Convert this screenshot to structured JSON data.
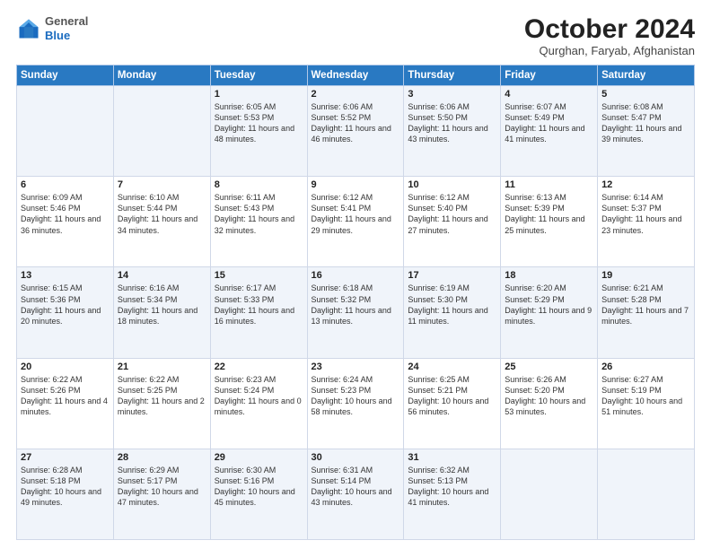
{
  "header": {
    "logo": {
      "general": "General",
      "blue": "Blue"
    },
    "title": "October 2024",
    "location": "Qurghan, Faryab, Afghanistan"
  },
  "weekdays": [
    "Sunday",
    "Monday",
    "Tuesday",
    "Wednesday",
    "Thursday",
    "Friday",
    "Saturday"
  ],
  "weeks": [
    [
      {
        "day": "",
        "sunrise": "",
        "sunset": "",
        "daylight": ""
      },
      {
        "day": "",
        "sunrise": "",
        "sunset": "",
        "daylight": ""
      },
      {
        "day": "1",
        "sunrise": "Sunrise: 6:05 AM",
        "sunset": "Sunset: 5:53 PM",
        "daylight": "Daylight: 11 hours and 48 minutes."
      },
      {
        "day": "2",
        "sunrise": "Sunrise: 6:06 AM",
        "sunset": "Sunset: 5:52 PM",
        "daylight": "Daylight: 11 hours and 46 minutes."
      },
      {
        "day": "3",
        "sunrise": "Sunrise: 6:06 AM",
        "sunset": "Sunset: 5:50 PM",
        "daylight": "Daylight: 11 hours and 43 minutes."
      },
      {
        "day": "4",
        "sunrise": "Sunrise: 6:07 AM",
        "sunset": "Sunset: 5:49 PM",
        "daylight": "Daylight: 11 hours and 41 minutes."
      },
      {
        "day": "5",
        "sunrise": "Sunrise: 6:08 AM",
        "sunset": "Sunset: 5:47 PM",
        "daylight": "Daylight: 11 hours and 39 minutes."
      }
    ],
    [
      {
        "day": "6",
        "sunrise": "Sunrise: 6:09 AM",
        "sunset": "Sunset: 5:46 PM",
        "daylight": "Daylight: 11 hours and 36 minutes."
      },
      {
        "day": "7",
        "sunrise": "Sunrise: 6:10 AM",
        "sunset": "Sunset: 5:44 PM",
        "daylight": "Daylight: 11 hours and 34 minutes."
      },
      {
        "day": "8",
        "sunrise": "Sunrise: 6:11 AM",
        "sunset": "Sunset: 5:43 PM",
        "daylight": "Daylight: 11 hours and 32 minutes."
      },
      {
        "day": "9",
        "sunrise": "Sunrise: 6:12 AM",
        "sunset": "Sunset: 5:41 PM",
        "daylight": "Daylight: 11 hours and 29 minutes."
      },
      {
        "day": "10",
        "sunrise": "Sunrise: 6:12 AM",
        "sunset": "Sunset: 5:40 PM",
        "daylight": "Daylight: 11 hours and 27 minutes."
      },
      {
        "day": "11",
        "sunrise": "Sunrise: 6:13 AM",
        "sunset": "Sunset: 5:39 PM",
        "daylight": "Daylight: 11 hours and 25 minutes."
      },
      {
        "day": "12",
        "sunrise": "Sunrise: 6:14 AM",
        "sunset": "Sunset: 5:37 PM",
        "daylight": "Daylight: 11 hours and 23 minutes."
      }
    ],
    [
      {
        "day": "13",
        "sunrise": "Sunrise: 6:15 AM",
        "sunset": "Sunset: 5:36 PM",
        "daylight": "Daylight: 11 hours and 20 minutes."
      },
      {
        "day": "14",
        "sunrise": "Sunrise: 6:16 AM",
        "sunset": "Sunset: 5:34 PM",
        "daylight": "Daylight: 11 hours and 18 minutes."
      },
      {
        "day": "15",
        "sunrise": "Sunrise: 6:17 AM",
        "sunset": "Sunset: 5:33 PM",
        "daylight": "Daylight: 11 hours and 16 minutes."
      },
      {
        "day": "16",
        "sunrise": "Sunrise: 6:18 AM",
        "sunset": "Sunset: 5:32 PM",
        "daylight": "Daylight: 11 hours and 13 minutes."
      },
      {
        "day": "17",
        "sunrise": "Sunrise: 6:19 AM",
        "sunset": "Sunset: 5:30 PM",
        "daylight": "Daylight: 11 hours and 11 minutes."
      },
      {
        "day": "18",
        "sunrise": "Sunrise: 6:20 AM",
        "sunset": "Sunset: 5:29 PM",
        "daylight": "Daylight: 11 hours and 9 minutes."
      },
      {
        "day": "19",
        "sunrise": "Sunrise: 6:21 AM",
        "sunset": "Sunset: 5:28 PM",
        "daylight": "Daylight: 11 hours and 7 minutes."
      }
    ],
    [
      {
        "day": "20",
        "sunrise": "Sunrise: 6:22 AM",
        "sunset": "Sunset: 5:26 PM",
        "daylight": "Daylight: 11 hours and 4 minutes."
      },
      {
        "day": "21",
        "sunrise": "Sunrise: 6:22 AM",
        "sunset": "Sunset: 5:25 PM",
        "daylight": "Daylight: 11 hours and 2 minutes."
      },
      {
        "day": "22",
        "sunrise": "Sunrise: 6:23 AM",
        "sunset": "Sunset: 5:24 PM",
        "daylight": "Daylight: 11 hours and 0 minutes."
      },
      {
        "day": "23",
        "sunrise": "Sunrise: 6:24 AM",
        "sunset": "Sunset: 5:23 PM",
        "daylight": "Daylight: 10 hours and 58 minutes."
      },
      {
        "day": "24",
        "sunrise": "Sunrise: 6:25 AM",
        "sunset": "Sunset: 5:21 PM",
        "daylight": "Daylight: 10 hours and 56 minutes."
      },
      {
        "day": "25",
        "sunrise": "Sunrise: 6:26 AM",
        "sunset": "Sunset: 5:20 PM",
        "daylight": "Daylight: 10 hours and 53 minutes."
      },
      {
        "day": "26",
        "sunrise": "Sunrise: 6:27 AM",
        "sunset": "Sunset: 5:19 PM",
        "daylight": "Daylight: 10 hours and 51 minutes."
      }
    ],
    [
      {
        "day": "27",
        "sunrise": "Sunrise: 6:28 AM",
        "sunset": "Sunset: 5:18 PM",
        "daylight": "Daylight: 10 hours and 49 minutes."
      },
      {
        "day": "28",
        "sunrise": "Sunrise: 6:29 AM",
        "sunset": "Sunset: 5:17 PM",
        "daylight": "Daylight: 10 hours and 47 minutes."
      },
      {
        "day": "29",
        "sunrise": "Sunrise: 6:30 AM",
        "sunset": "Sunset: 5:16 PM",
        "daylight": "Daylight: 10 hours and 45 minutes."
      },
      {
        "day": "30",
        "sunrise": "Sunrise: 6:31 AM",
        "sunset": "Sunset: 5:14 PM",
        "daylight": "Daylight: 10 hours and 43 minutes."
      },
      {
        "day": "31",
        "sunrise": "Sunrise: 6:32 AM",
        "sunset": "Sunset: 5:13 PM",
        "daylight": "Daylight: 10 hours and 41 minutes."
      },
      {
        "day": "",
        "sunrise": "",
        "sunset": "",
        "daylight": ""
      },
      {
        "day": "",
        "sunrise": "",
        "sunset": "",
        "daylight": ""
      }
    ]
  ]
}
